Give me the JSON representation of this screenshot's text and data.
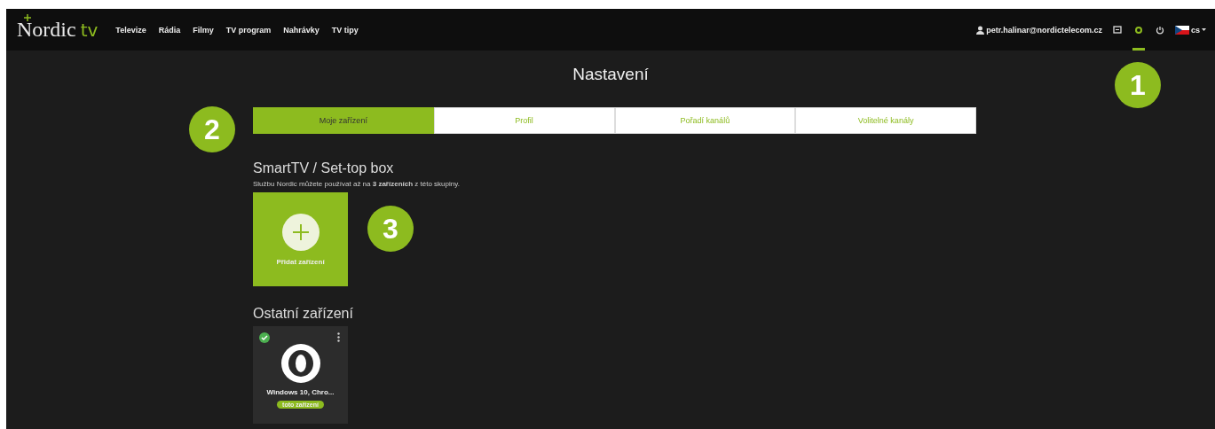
{
  "logo": {
    "text": "N",
    "rest": "ordic",
    "tv": "tv"
  },
  "nav": [
    "Televize",
    "Rádia",
    "Filmy",
    "TV program",
    "Nahrávky",
    "TV tipy"
  ],
  "user": "petr.halinar@nordictelecom.cz",
  "toolbar": [
    {
      "kind": "mail",
      "selected": false
    },
    {
      "kind": "settings",
      "selected": true
    },
    {
      "kind": "power",
      "selected": false
    }
  ],
  "language": "cs",
  "page_title": "Nastavení",
  "tabs": [
    {
      "label": "Moje zařízení",
      "selected": true
    },
    {
      "label": "Profil",
      "selected": false
    },
    {
      "label": "Pořadí kanálů",
      "selected": false
    },
    {
      "label": "Volitelné kanály",
      "selected": false
    }
  ],
  "section_title": "SmartTV / Set-top box",
  "section_note": "Službu Nordic můžete používat až na **3 zařízeních** z této skupiny.",
  "add_device": "Přidat zařízení",
  "other_title": "Ostatní zařízení",
  "devices": [
    {
      "name": "Windows 10, Chro...",
      "badge": "toto zařízení",
      "verified": true
    }
  ],
  "callouts": [
    "1",
    "2",
    "3"
  ]
}
